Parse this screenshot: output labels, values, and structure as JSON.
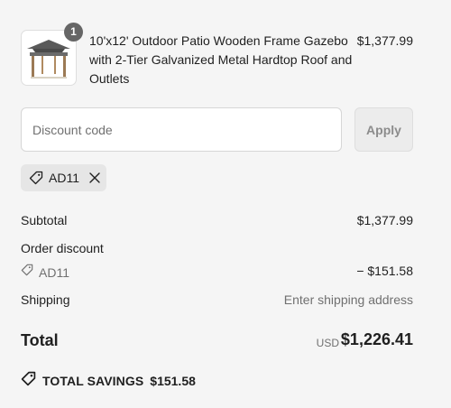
{
  "product": {
    "quantity": "1",
    "name": "10'x12' Outdoor Patio Wooden Frame Gazebo with 2-Tier Galvanized Metal Hardtop Roof and Outlets",
    "price": "$1,377.99",
    "image_icon": "gazebo-image"
  },
  "discount": {
    "placeholder": "Discount code",
    "value": "",
    "apply_label": "Apply",
    "applied_code": "AD11"
  },
  "summary": {
    "subtotal_label": "Subtotal",
    "subtotal_value": "$1,377.99",
    "order_discount_label": "Order discount",
    "order_discount_code": "AD11",
    "order_discount_value": "− $151.58",
    "shipping_label": "Shipping",
    "shipping_value": "Enter shipping address",
    "total_label": "Total",
    "total_currency": "USD",
    "total_value": "$1,226.41",
    "savings_label": "TOTAL SAVINGS",
    "savings_value": "$151.58"
  },
  "colors": {
    "background": "#f5f5f5",
    "text": "#1f1f1f",
    "muted": "#707070",
    "badge": "#666666"
  }
}
